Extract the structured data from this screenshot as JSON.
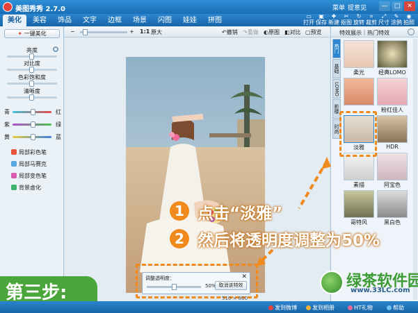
{
  "titlebar": {
    "app_title": "美图秀秀 2.7.0",
    "menu": "菜单",
    "feedback": "提意见",
    "min": "—",
    "max": "□",
    "close": "✕"
  },
  "tabs": [
    "美化",
    "美容",
    "饰品",
    "文字",
    "边框",
    "场景",
    "闪图",
    "娃娃",
    "拼图"
  ],
  "active_tab": "美化",
  "toolbar_tools": [
    "打开",
    "保存",
    "新建",
    "抠图",
    "旋转",
    "裁剪",
    "尺寸",
    "涂鸦",
    "拍照"
  ],
  "left_panel": {
    "one_key": "一键美化",
    "adjustments": [
      "亮度",
      "对比度",
      "色彩饱和度",
      "清晰度"
    ],
    "color_rows": [
      {
        "left": "青",
        "right": "红"
      },
      {
        "left": "紫",
        "right": "绿"
      },
      {
        "left": "黄",
        "right": "蓝"
      }
    ],
    "tools": [
      "局部彩色笔",
      "局部马赛克",
      "局部变色笔",
      "背景虚化"
    ]
  },
  "canvas_toolbar": {
    "zoom_minus": "−",
    "zoom_plus": "+",
    "ratio": "1:1",
    "original_size": "原大",
    "undo": "撤销",
    "redo": "重做",
    "original": "原图",
    "compare": "对比",
    "preview": "预览"
  },
  "opacity_panel": {
    "label": "调整透明度：",
    "close": "✕",
    "value": "50%",
    "value_fraction": 0.5,
    "cancel": "取消该特效"
  },
  "image_size": "510 × 800",
  "right_panel": {
    "title": "特效展示｜热门特效",
    "vertical_tabs": [
      "热门",
      "基础",
      "LOMO",
      "影楼",
      "时尚"
    ],
    "active_vtab": "热门",
    "effects": [
      "柔光",
      "经典LOMO",
      "",
      "粉红佳人",
      "淡雅",
      "HDR",
      "素描",
      "阿宝色",
      "哥特风",
      "黑白色"
    ],
    "selected_effect": "淡雅"
  },
  "statusbar": {
    "items": [
      "发到微博",
      "发到相册",
      "HT礼物",
      "帮助"
    ],
    "left_text": ""
  },
  "step_badge": "第三步:",
  "annotations": [
    {
      "num": "1",
      "text": "点击“淡雅”"
    },
    {
      "num": "2",
      "text": "然后将透明度调整为50%"
    }
  ],
  "watermark": {
    "name": "绿茶软件园",
    "url": "www.33LC.com"
  },
  "colors": {
    "accent": "#2b86cf",
    "annotation_orange": "#f08a1c",
    "step_green": "#4aa53a"
  }
}
